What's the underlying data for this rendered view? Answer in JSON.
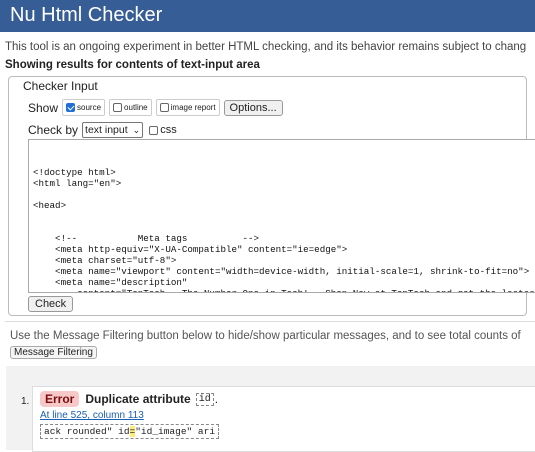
{
  "header": {
    "title": "Nu Html Checker"
  },
  "intro": "This tool is an ongoing experiment in better HTML checking, and its behavior remains subject to chang",
  "showing": "Showing results for contents of text-input area",
  "checker_input": {
    "legend": "Checker Input",
    "show_label": "Show",
    "options": [
      {
        "label": "source",
        "checked": true
      },
      {
        "label": "outline",
        "checked": false
      },
      {
        "label": "image report",
        "checked": false
      }
    ],
    "options_button": "Options...",
    "check_by_label": "Check by",
    "check_by_value": "text input",
    "css_label": "css",
    "css_checked": false,
    "source_lines": [
      "<!doctype html>",
      "<html lang=\"en\">",
      "",
      "<head>",
      "",
      "",
      "    <!--           Meta tags          -->",
      "    <meta http-equiv=\"X-UA-Compatible\" content=\"ie=edge\">",
      "    <meta charset=\"utf-8\">",
      "    <meta name=\"viewport\" content=\"width=device-width, initial-scale=1, shrink-to-fit=no\">",
      "    <meta name=\"description\"",
      "        content=\"TopTech - The Number One in Tech! - Shop Now at TopTech and get the lastest"
    ],
    "check_button": "Check"
  },
  "filter": {
    "text": "Use the Message Filtering button below to hide/show particular messages, and to see total counts of",
    "button": "Message Filtering"
  },
  "messages": [
    {
      "number": "1.",
      "type": "Error",
      "message": "Duplicate attribute",
      "attribute": "id",
      "trailing": ".",
      "location": "At line 525, column 113",
      "extract_before": "ack rounded\" id",
      "extract_highlight": "=",
      "extract_after": "\"id_image\" ari"
    }
  ]
}
